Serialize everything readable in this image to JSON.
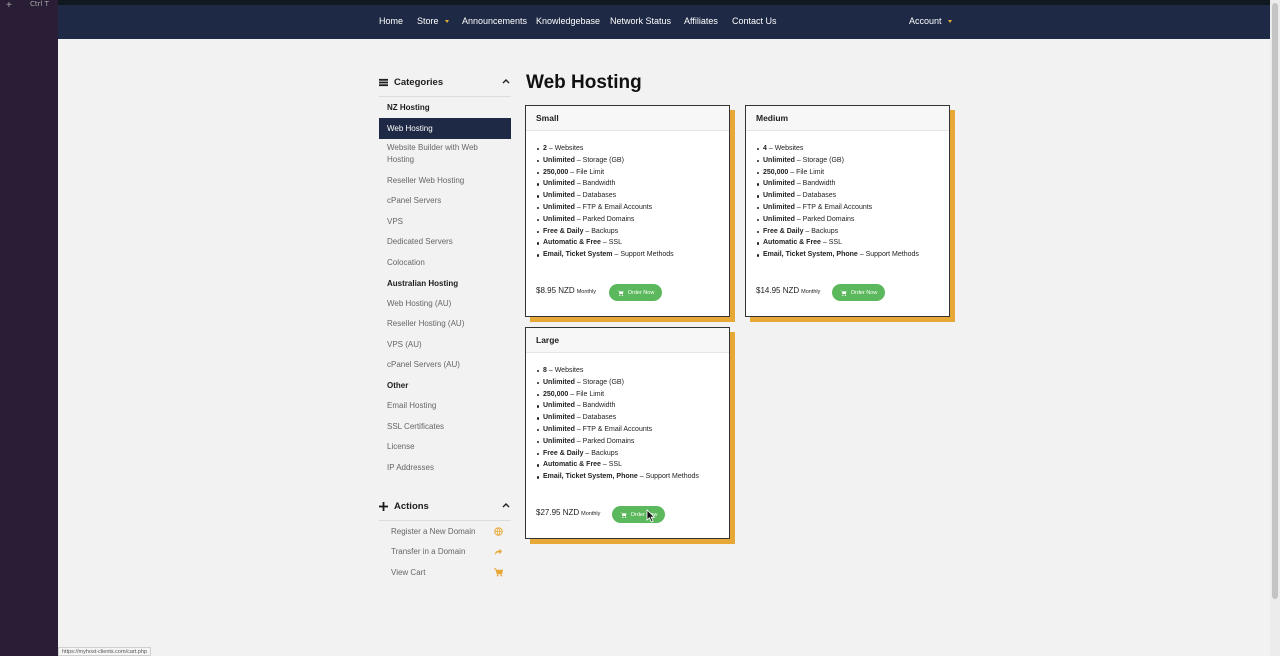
{
  "os": {
    "plus": "+",
    "shortcut": "Ctrl T"
  },
  "nav": {
    "items": [
      "Home",
      "Store",
      "Announcements",
      "Knowledgebase",
      "Network Status",
      "Affiliates",
      "Contact Us"
    ],
    "account": "Account"
  },
  "sidebar": {
    "categories_title": "Categories",
    "groups": [
      {
        "label": "NZ Hosting"
      },
      {
        "label": "Australian Hosting"
      },
      {
        "label": "Other"
      }
    ],
    "items": [
      "Web Hosting",
      "Website Builder with Web Hosting",
      "Reseller Web Hosting",
      "cPanel Servers",
      "VPS",
      "Dedicated Servers",
      "Colocation",
      "Web Hosting (AU)",
      "Reseller Hosting (AU)",
      "VPS (AU)",
      "cPanel Servers (AU)",
      "Email Hosting",
      "SSL Certificates",
      "License",
      "IP Addresses"
    ],
    "actions_title": "Actions",
    "actions": [
      "Register a New Domain",
      "Transfer in a Domain",
      "View Cart"
    ]
  },
  "main": {
    "title": "Web Hosting",
    "order_label": "Order Now",
    "plans": [
      {
        "name": "Small",
        "price": "$8.95 NZD",
        "period": "Monthly",
        "features": [
          {
            "b": "2",
            "t": " – Websites"
          },
          {
            "b": "Unlimited",
            "t": " – Storage (GB)"
          },
          {
            "b": "250,000",
            "t": " – File Limit"
          },
          {
            "b": "Unlimited",
            "t": " – Bandwidth"
          },
          {
            "b": "Unlimited",
            "t": " – Databases"
          },
          {
            "b": "Unlimited",
            "t": " – FTP & Email Accounts"
          },
          {
            "b": "Unlimited",
            "t": " – Parked Domains"
          },
          {
            "b": "Free & Daily",
            "t": " – Backups"
          },
          {
            "b": "Automatic & Free",
            "t": " – SSL"
          },
          {
            "b": "Email, Ticket System",
            "t": " – Support Methods"
          }
        ]
      },
      {
        "name": "Medium",
        "price": "$14.95 NZD",
        "period": "Monthly",
        "features": [
          {
            "b": "4",
            "t": " – Websites"
          },
          {
            "b": "Unlimited",
            "t": " – Storage (GB)"
          },
          {
            "b": "250,000",
            "t": " – File Limit"
          },
          {
            "b": "Unlimited",
            "t": " – Bandwidth"
          },
          {
            "b": "Unlimited",
            "t": " – Databases"
          },
          {
            "b": "Unlimited",
            "t": " – FTP & Email Accounts"
          },
          {
            "b": "Unlimited",
            "t": " – Parked Domains"
          },
          {
            "b": "Free & Daily",
            "t": " – Backups"
          },
          {
            "b": "Automatic & Free",
            "t": " – SSL"
          },
          {
            "b": "Email, Ticket System, Phone",
            "t": " – Support Methods"
          }
        ]
      },
      {
        "name": "Large",
        "price": "$27.95 NZD",
        "period": "Monthly",
        "features": [
          {
            "b": "8",
            "t": " – Websites"
          },
          {
            "b": "Unlimited",
            "t": " – Storage (GB)"
          },
          {
            "b": "250,000",
            "t": " – File Limit"
          },
          {
            "b": "Unlimited",
            "t": " – Bandwidth"
          },
          {
            "b": "Unlimited",
            "t": " – Databases"
          },
          {
            "b": "Unlimited",
            "t": " – FTP & Email Accounts"
          },
          {
            "b": "Unlimited",
            "t": " – Parked Domains"
          },
          {
            "b": "Free & Daily",
            "t": " – Backups"
          },
          {
            "b": "Automatic & Free",
            "t": " – SSL"
          },
          {
            "b": "Email, Ticket System, Phone",
            "t": " – Support Methods"
          }
        ]
      }
    ]
  },
  "status_url": "https://myhost-clients.com/cart.php",
  "colors": {
    "nav": "#1e2a45",
    "accent": "#e8a838",
    "order": "#5cb85c",
    "action_icon": "#e8a838"
  }
}
